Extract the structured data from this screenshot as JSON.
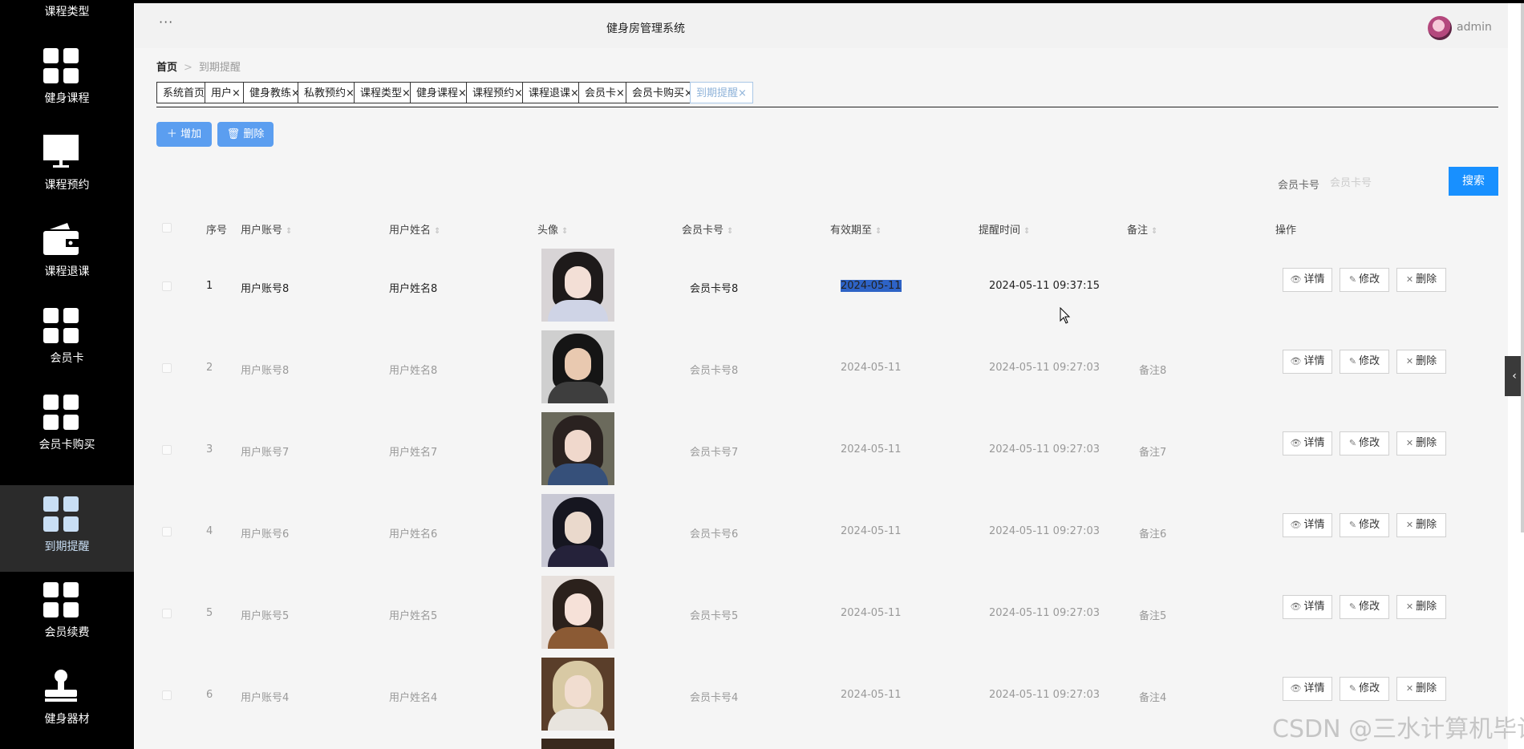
{
  "sidebar": {
    "items": [
      {
        "label": "课程类型",
        "icon": "bars-icon",
        "active": false
      },
      {
        "label": "健身课程",
        "icon": "grid-icon",
        "active": false
      },
      {
        "label": "课程预约",
        "icon": "monitor-icon",
        "active": false
      },
      {
        "label": "课程退课",
        "icon": "wallet-icon",
        "active": false
      },
      {
        "label": "会员卡",
        "icon": "grid-icon",
        "active": false
      },
      {
        "label": "会员卡购买",
        "icon": "grid-icon",
        "active": false
      },
      {
        "label": "到期提醒",
        "icon": "grid-icon",
        "active": true
      },
      {
        "label": "会员续费",
        "icon": "grid-icon",
        "active": false
      },
      {
        "label": "健身器材",
        "icon": "stamp-icon",
        "active": false
      }
    ]
  },
  "header": {
    "menu_icon": "more-icon",
    "title": "健身房管理系统",
    "username": "admin"
  },
  "breadcrumb": {
    "home": "首页",
    "current": "到期提醒"
  },
  "tabs": [
    {
      "label": "系统首页",
      "closable": false
    },
    {
      "label": "用户",
      "closable": true
    },
    {
      "label": "健身教练",
      "closable": true
    },
    {
      "label": "私教预约",
      "closable": true
    },
    {
      "label": "课程类型",
      "closable": true
    },
    {
      "label": "健身课程",
      "closable": true
    },
    {
      "label": "课程预约",
      "closable": true
    },
    {
      "label": "课程退课",
      "closable": true
    },
    {
      "label": "会员卡",
      "closable": true
    },
    {
      "label": "会员卡购买",
      "closable": true
    },
    {
      "label": "到期提醒",
      "closable": true,
      "active": true
    }
  ],
  "toolbar": {
    "add_label": "增加",
    "delete_label": "删除"
  },
  "search": {
    "label": "会员卡号",
    "placeholder": "会员卡号",
    "button": "搜索"
  },
  "table": {
    "columns": [
      "序号",
      "用户账号",
      "用户姓名",
      "头像",
      "会员卡号",
      "有效期至",
      "提醒时间",
      "备注",
      "操作"
    ],
    "actions": {
      "detail": "详情",
      "edit": "修改",
      "remove": "删除"
    },
    "rows": [
      {
        "index": "1",
        "account": "用户账号8",
        "name": "用户姓名8",
        "card": "会员卡号8",
        "expire": "2024-05-11",
        "remind": "2024-05-11 09:37:15",
        "note": ""
      },
      {
        "index": "2",
        "account": "用户账号8",
        "name": "用户姓名8",
        "card": "会员卡号8",
        "expire": "2024-05-11",
        "remind": "2024-05-11 09:27:03",
        "note": "备注8"
      },
      {
        "index": "3",
        "account": "用户账号7",
        "name": "用户姓名7",
        "card": "会员卡号7",
        "expire": "2024-05-11",
        "remind": "2024-05-11 09:27:03",
        "note": "备注7"
      },
      {
        "index": "4",
        "account": "用户账号6",
        "name": "用户姓名6",
        "card": "会员卡号6",
        "expire": "2024-05-11",
        "remind": "2024-05-11 09:27:03",
        "note": "备注6"
      },
      {
        "index": "5",
        "account": "用户账号5",
        "name": "用户姓名5",
        "card": "会员卡号5",
        "expire": "2024-05-11",
        "remind": "2024-05-11 09:27:03",
        "note": "备注5"
      },
      {
        "index": "6",
        "account": "用户账号4",
        "name": "用户姓名4",
        "card": "会员卡号4",
        "expire": "2024-05-11",
        "remind": "2024-05-11 09:27:03",
        "note": "备注4"
      }
    ]
  },
  "colors": {
    "accent": "#1890ff",
    "button": "#5b9ef0",
    "sidebar": "#000000",
    "active_nav": "#c8def4",
    "selection": "#2e63c6"
  },
  "watermark": "CSDN @三水计算机毕设程序"
}
